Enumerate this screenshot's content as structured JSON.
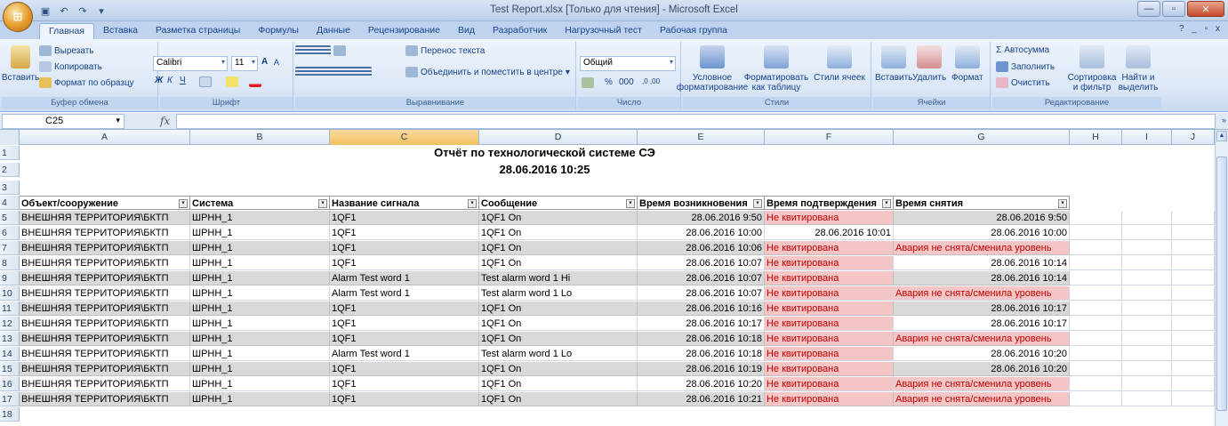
{
  "window": {
    "title": "Test Report.xlsx  [Только для чтения] - Microsoft Excel",
    "minimize": "—",
    "maximize": "▫",
    "close": "✕"
  },
  "ribbon_tabs": [
    "Главная",
    "Вставка",
    "Разметка страницы",
    "Формулы",
    "Данные",
    "Рецензирование",
    "Вид",
    "Разработчик",
    "Нагрузочный тест",
    "Рабочая группа"
  ],
  "ribbon_help": "? _ ▫ x",
  "clipboard": {
    "paste": "Вставить",
    "cut": "Вырезать",
    "copy": "Копировать",
    "format_painter": "Формат по образцу",
    "label": "Буфер обмена"
  },
  "font": {
    "name": "Calibri",
    "size": "11",
    "grow": "A",
    "shrink": "A",
    "bold": "Ж",
    "italic": "К",
    "underline": "Ч",
    "label": "Шрифт"
  },
  "alignment": {
    "wrap": "Перенос текста",
    "merge": "Объединить и поместить в центре",
    "label": "Выравнивание"
  },
  "number": {
    "format": "Общий",
    "percent": "%",
    "thousands": "000",
    "inc_dec": ",0 ,00",
    "label": "Число"
  },
  "styles": {
    "conditional": "Условное форматирование",
    "as_table": "Форматировать как таблицу",
    "cell_styles": "Стили ячеек",
    "label": "Стили"
  },
  "cells": {
    "insert": "Вставить",
    "delete": "Удалить",
    "format": "Формат",
    "label": "Ячейки"
  },
  "editing": {
    "autosum": "Автосумма",
    "fill": "Заполнить",
    "clear": "Очистить",
    "sort": "Сортировка и фильтр",
    "find": "Найти и выделить",
    "label": "Редактирование"
  },
  "formula_bar": {
    "name_box": "C25",
    "fx": "fx",
    "value": ""
  },
  "columns": [
    "A",
    "B",
    "C",
    "D",
    "E",
    "F",
    "G",
    "H",
    "I",
    "J"
  ],
  "selected_column": "C",
  "report": {
    "title": "Отчёт по технологической системе СЭ",
    "date": "28.06.2016 10:25"
  },
  "table_headers": [
    "Объект/сооружение",
    "Система",
    "Название сигнала",
    "Сообщение",
    "Время возникновения",
    "Время подтверждения",
    "Время снятия"
  ],
  "rows": [
    {
      "n": "5",
      "gray": true,
      "a": "ВНЕШНЯЯ ТЕРРИТОРИЯ\\БКТП",
      "b": "ШРНН_1",
      "c": "1QF1",
      "d": "1QF1 On",
      "e": "28.06.2016 9:50",
      "f": "Не квитирована",
      "f_red": true,
      "g": "28.06.2016 9:50",
      "g_red": false
    },
    {
      "n": "6",
      "gray": false,
      "a": "ВНЕШНЯЯ ТЕРРИТОРИЯ\\БКТП",
      "b": "ШРНН_1",
      "c": "1QF1",
      "d": "1QF1 On",
      "e": "28.06.2016 10:00",
      "f": "28.06.2016 10:01",
      "f_red": false,
      "g": "28.06.2016 10:00",
      "g_red": false
    },
    {
      "n": "7",
      "gray": true,
      "a": "ВНЕШНЯЯ ТЕРРИТОРИЯ\\БКТП",
      "b": "ШРНН_1",
      "c": "1QF1",
      "d": "1QF1 On",
      "e": "28.06.2016 10:06",
      "f": "Не квитирована",
      "f_red": true,
      "g": "Авария не снята/сменила уровень",
      "g_red": true
    },
    {
      "n": "8",
      "gray": false,
      "a": "ВНЕШНЯЯ ТЕРРИТОРИЯ\\БКТП",
      "b": "ШРНН_1",
      "c": "1QF1",
      "d": "1QF1 On",
      "e": "28.06.2016 10:07",
      "f": "Не квитирована",
      "f_red": true,
      "g": "28.06.2016 10:14",
      "g_red": false
    },
    {
      "n": "9",
      "gray": true,
      "a": "ВНЕШНЯЯ ТЕРРИТОРИЯ\\БКТП",
      "b": "ШРНН_1",
      "c": "Alarm Test word 1",
      "d": "Test alarm word 1 Hi",
      "e": "28.06.2016 10:07",
      "f": "Не квитирована",
      "f_red": true,
      "g": "28.06.2016 10:14",
      "g_red": false
    },
    {
      "n": "10",
      "gray": false,
      "a": "ВНЕШНЯЯ ТЕРРИТОРИЯ\\БКТП",
      "b": "ШРНН_1",
      "c": "Alarm Test word 1",
      "d": "Test alarm word 1 Lo",
      "e": "28.06.2016 10:07",
      "f": "Не квитирована",
      "f_red": true,
      "g": "Авария не снята/сменила уровень",
      "g_red": true
    },
    {
      "n": "11",
      "gray": true,
      "a": "ВНЕШНЯЯ ТЕРРИТОРИЯ\\БКТП",
      "b": "ШРНН_1",
      "c": "1QF1",
      "d": "1QF1 On",
      "e": "28.06.2016 10:16",
      "f": "Не квитирована",
      "f_red": true,
      "g": "28.06.2016 10:17",
      "g_red": false
    },
    {
      "n": "12",
      "gray": false,
      "a": "ВНЕШНЯЯ ТЕРРИТОРИЯ\\БКТП",
      "b": "ШРНН_1",
      "c": "1QF1",
      "d": "1QF1 On",
      "e": "28.06.2016 10:17",
      "f": "Не квитирована",
      "f_red": true,
      "g": "28.06.2016 10:17",
      "g_red": false
    },
    {
      "n": "13",
      "gray": true,
      "a": "ВНЕШНЯЯ ТЕРРИТОРИЯ\\БКТП",
      "b": "ШРНН_1",
      "c": "1QF1",
      "d": "1QF1 On",
      "e": "28.06.2016 10:18",
      "f": "Не квитирована",
      "f_red": true,
      "g": "Авария не снята/сменила уровень",
      "g_red": true
    },
    {
      "n": "14",
      "gray": false,
      "a": "ВНЕШНЯЯ ТЕРРИТОРИЯ\\БКТП",
      "b": "ШРНН_1",
      "c": "Alarm Test word 1",
      "d": "Test alarm word 1 Lo",
      "e": "28.06.2016 10:18",
      "f": "Не квитирована",
      "f_red": true,
      "g": "28.06.2016 10:20",
      "g_red": false
    },
    {
      "n": "15",
      "gray": true,
      "a": "ВНЕШНЯЯ ТЕРРИТОРИЯ\\БКТП",
      "b": "ШРНН_1",
      "c": "1QF1",
      "d": "1QF1 On",
      "e": "28.06.2016 10:19",
      "f": "Не квитирована",
      "f_red": true,
      "g": "28.06.2016 10:20",
      "g_red": false
    },
    {
      "n": "16",
      "gray": false,
      "a": "ВНЕШНЯЯ ТЕРРИТОРИЯ\\БКТП",
      "b": "ШРНН_1",
      "c": "1QF1",
      "d": "1QF1 On",
      "e": "28.06.2016 10:20",
      "f": "Не квитирована",
      "f_red": true,
      "g": "Авария не снята/сменила уровень",
      "g_red": true
    },
    {
      "n": "17",
      "gray": true,
      "a": "ВНЕШНЯЯ ТЕРРИТОРИЯ\\БКТП",
      "b": "ШРНН_1",
      "c": "1QF1",
      "d": "1QF1 On",
      "e": "28.06.2016 10:21",
      "f": "Не квитирована",
      "f_red": true,
      "g": "Авария не снята/сменила уровень",
      "g_red": true
    }
  ],
  "row_numbers_top": [
    "1",
    "2",
    "3",
    "4"
  ],
  "row_number_last": "18",
  "colors": {
    "gray_row": "#d9d9d9",
    "red_fill": "#f6c6c6",
    "red_text": "#c00000",
    "selected_col": "#f1c15f"
  }
}
